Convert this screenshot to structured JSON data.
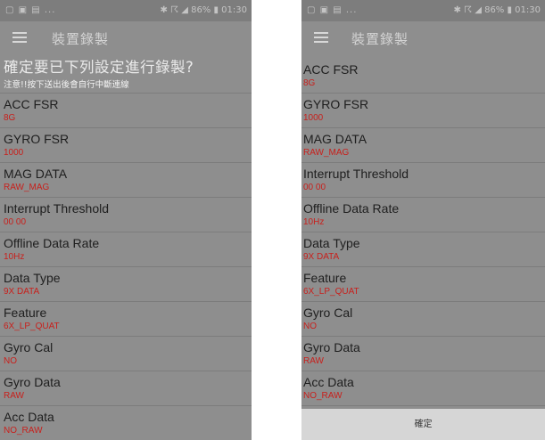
{
  "status_bar": {
    "left_icons": "▢ ▣ ▤ ...",
    "right_text": "✱ ☈ ◢ 86% ▮ 01:30"
  },
  "app_bar": {
    "title": "裝置錄製",
    "menu_icon": "hamburger-menu-icon"
  },
  "dialog": {
    "heading": "確定要已下列設定進行錄製?",
    "note": "注意!!按下送出後會自行中斷連線"
  },
  "left_items": [
    {
      "label": "ACC FSR",
      "value": "8G"
    },
    {
      "label": "GYRO FSR",
      "value": "1000"
    },
    {
      "label": "MAG DATA",
      "value": "RAW_MAG"
    },
    {
      "label": "Interrupt Threshold",
      "value": "00 00"
    },
    {
      "label": "Offline Data Rate",
      "value": "10Hz"
    },
    {
      "label": "Data Type",
      "value": "9X DATA"
    },
    {
      "label": "Feature",
      "value": "6X_LP_QUAT"
    },
    {
      "label": "Gyro Cal",
      "value": "NO"
    },
    {
      "label": "Gyro Data",
      "value": "RAW"
    },
    {
      "label": "Acc Data",
      "value": "NO_RAW"
    }
  ],
  "right_items": [
    {
      "label": "ACC FSR",
      "value": "8G"
    },
    {
      "label": "GYRO FSR",
      "value": "1000"
    },
    {
      "label": "MAG DATA",
      "value": "RAW_MAG"
    },
    {
      "label": "Interrupt Threshold",
      "value": "00 00"
    },
    {
      "label": "Offline Data Rate",
      "value": "10Hz"
    },
    {
      "label": "Data Type",
      "value": "9X DATA"
    },
    {
      "label": "Feature",
      "value": "6X_LP_QUAT"
    },
    {
      "label": "Gyro Cal",
      "value": "NO"
    },
    {
      "label": "Gyro Data",
      "value": "RAW"
    },
    {
      "label": "Acc Data",
      "value": "NO_RAW"
    }
  ],
  "confirm_button": {
    "label": "確定"
  },
  "colors": {
    "screen_bg": "#8e8e8e",
    "label": "#1e1e1e",
    "value": "#c8201c",
    "confirm_bg": "#d6d6d6"
  }
}
